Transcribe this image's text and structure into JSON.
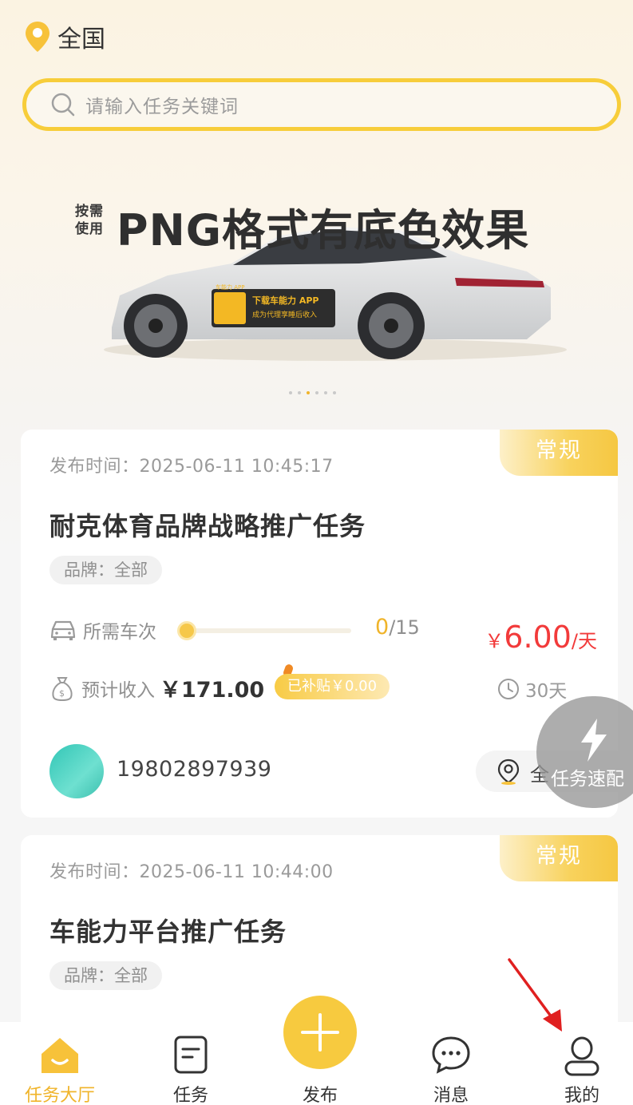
{
  "location": {
    "label": "全国"
  },
  "search": {
    "placeholder": "请输入任务关键词"
  },
  "banner": {
    "tag_line1": "按需",
    "tag_line2": "使用",
    "title": "PNG格式有底色效果",
    "sticker_line1": "下载车能力 APP",
    "sticker_line2": "成为代理享睡后收入",
    "sticker_brand": "车能力 APP",
    "carousel_count": 6,
    "carousel_active": 2
  },
  "tasks": [
    {
      "tag": "常规",
      "published_label": "发布时间：",
      "published": "2025-06-11 10:45:17",
      "title": "耐克体育品牌战略推广任务",
      "brand": "品牌：全部",
      "vehicle_label": "所需车次",
      "done": "0",
      "total": "/15",
      "progress": 0,
      "price_symbol": "￥",
      "price": "6.00",
      "price_unit": "/天",
      "income_label": "预计收入",
      "income": "￥171.00",
      "subsidy": "已补贴￥0.00",
      "duration": "30天",
      "publisher": "19802897939",
      "region": "全"
    },
    {
      "tag": "常规",
      "published_label": "发布时间：",
      "published": "2025-06-11 10:44:00",
      "title": "车能力平台推广任务",
      "brand": "品牌：全部"
    }
  ],
  "fab": {
    "label": "任务速配"
  },
  "tabbar": {
    "items": [
      {
        "label": "任务大厅",
        "icon": "home-icon",
        "active": true
      },
      {
        "label": "任务",
        "icon": "document-icon",
        "active": false
      },
      {
        "label": "发布",
        "icon": "plus-icon",
        "active": false
      },
      {
        "label": "消息",
        "icon": "chat-icon",
        "active": false
      },
      {
        "label": "我的",
        "icon": "user-icon",
        "active": false
      }
    ]
  },
  "colors": {
    "accent": "#f7ca3f",
    "price": "#f23a3a",
    "annotation_arrow": "#e02020"
  }
}
